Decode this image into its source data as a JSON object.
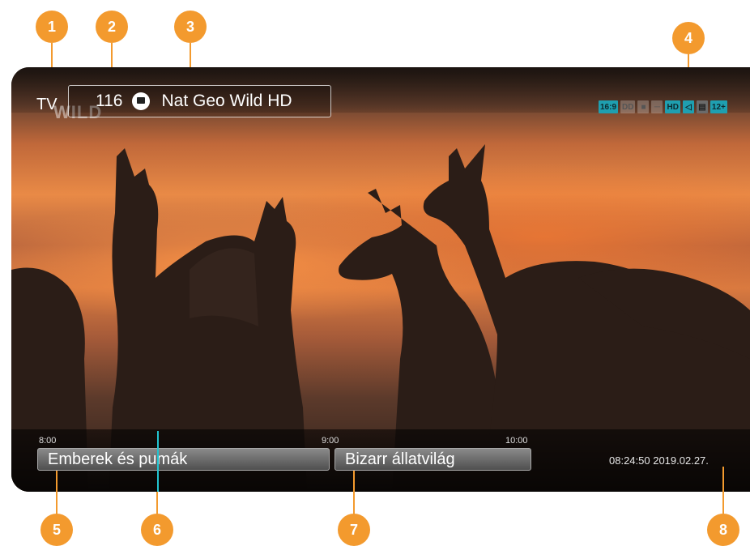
{
  "markers": [
    "1",
    "2",
    "3",
    "4",
    "5",
    "6",
    "7",
    "8"
  ],
  "header": {
    "mode_label": "TV",
    "channel_number": "116",
    "channel_name": "Nat Geo Wild HD",
    "logo_text": "WILD"
  },
  "status_icons": [
    {
      "name": "aspect-16-9-icon",
      "text": "16:9",
      "style": "teal"
    },
    {
      "name": "dolby-icon",
      "text": "DD",
      "style": "dim"
    },
    {
      "name": "lock-icon",
      "text": "",
      "style": "dim"
    },
    {
      "name": "subtitle-icon",
      "text": "",
      "style": "dim"
    },
    {
      "name": "hd-icon",
      "text": "HD",
      "style": "teal"
    },
    {
      "name": "audio-icon",
      "text": "",
      "style": "teal"
    },
    {
      "name": "teletext-icon",
      "text": "",
      "style": "grey"
    },
    {
      "name": "age-rating-icon",
      "text": "12+",
      "style": "teal"
    }
  ],
  "timeline": {
    "times": [
      "8:00",
      "9:00",
      "10:00"
    ],
    "programs": [
      "Emberek és pumák",
      "Bizarr állatvilág"
    ],
    "clock": "08:24:50 2019.02.27."
  }
}
